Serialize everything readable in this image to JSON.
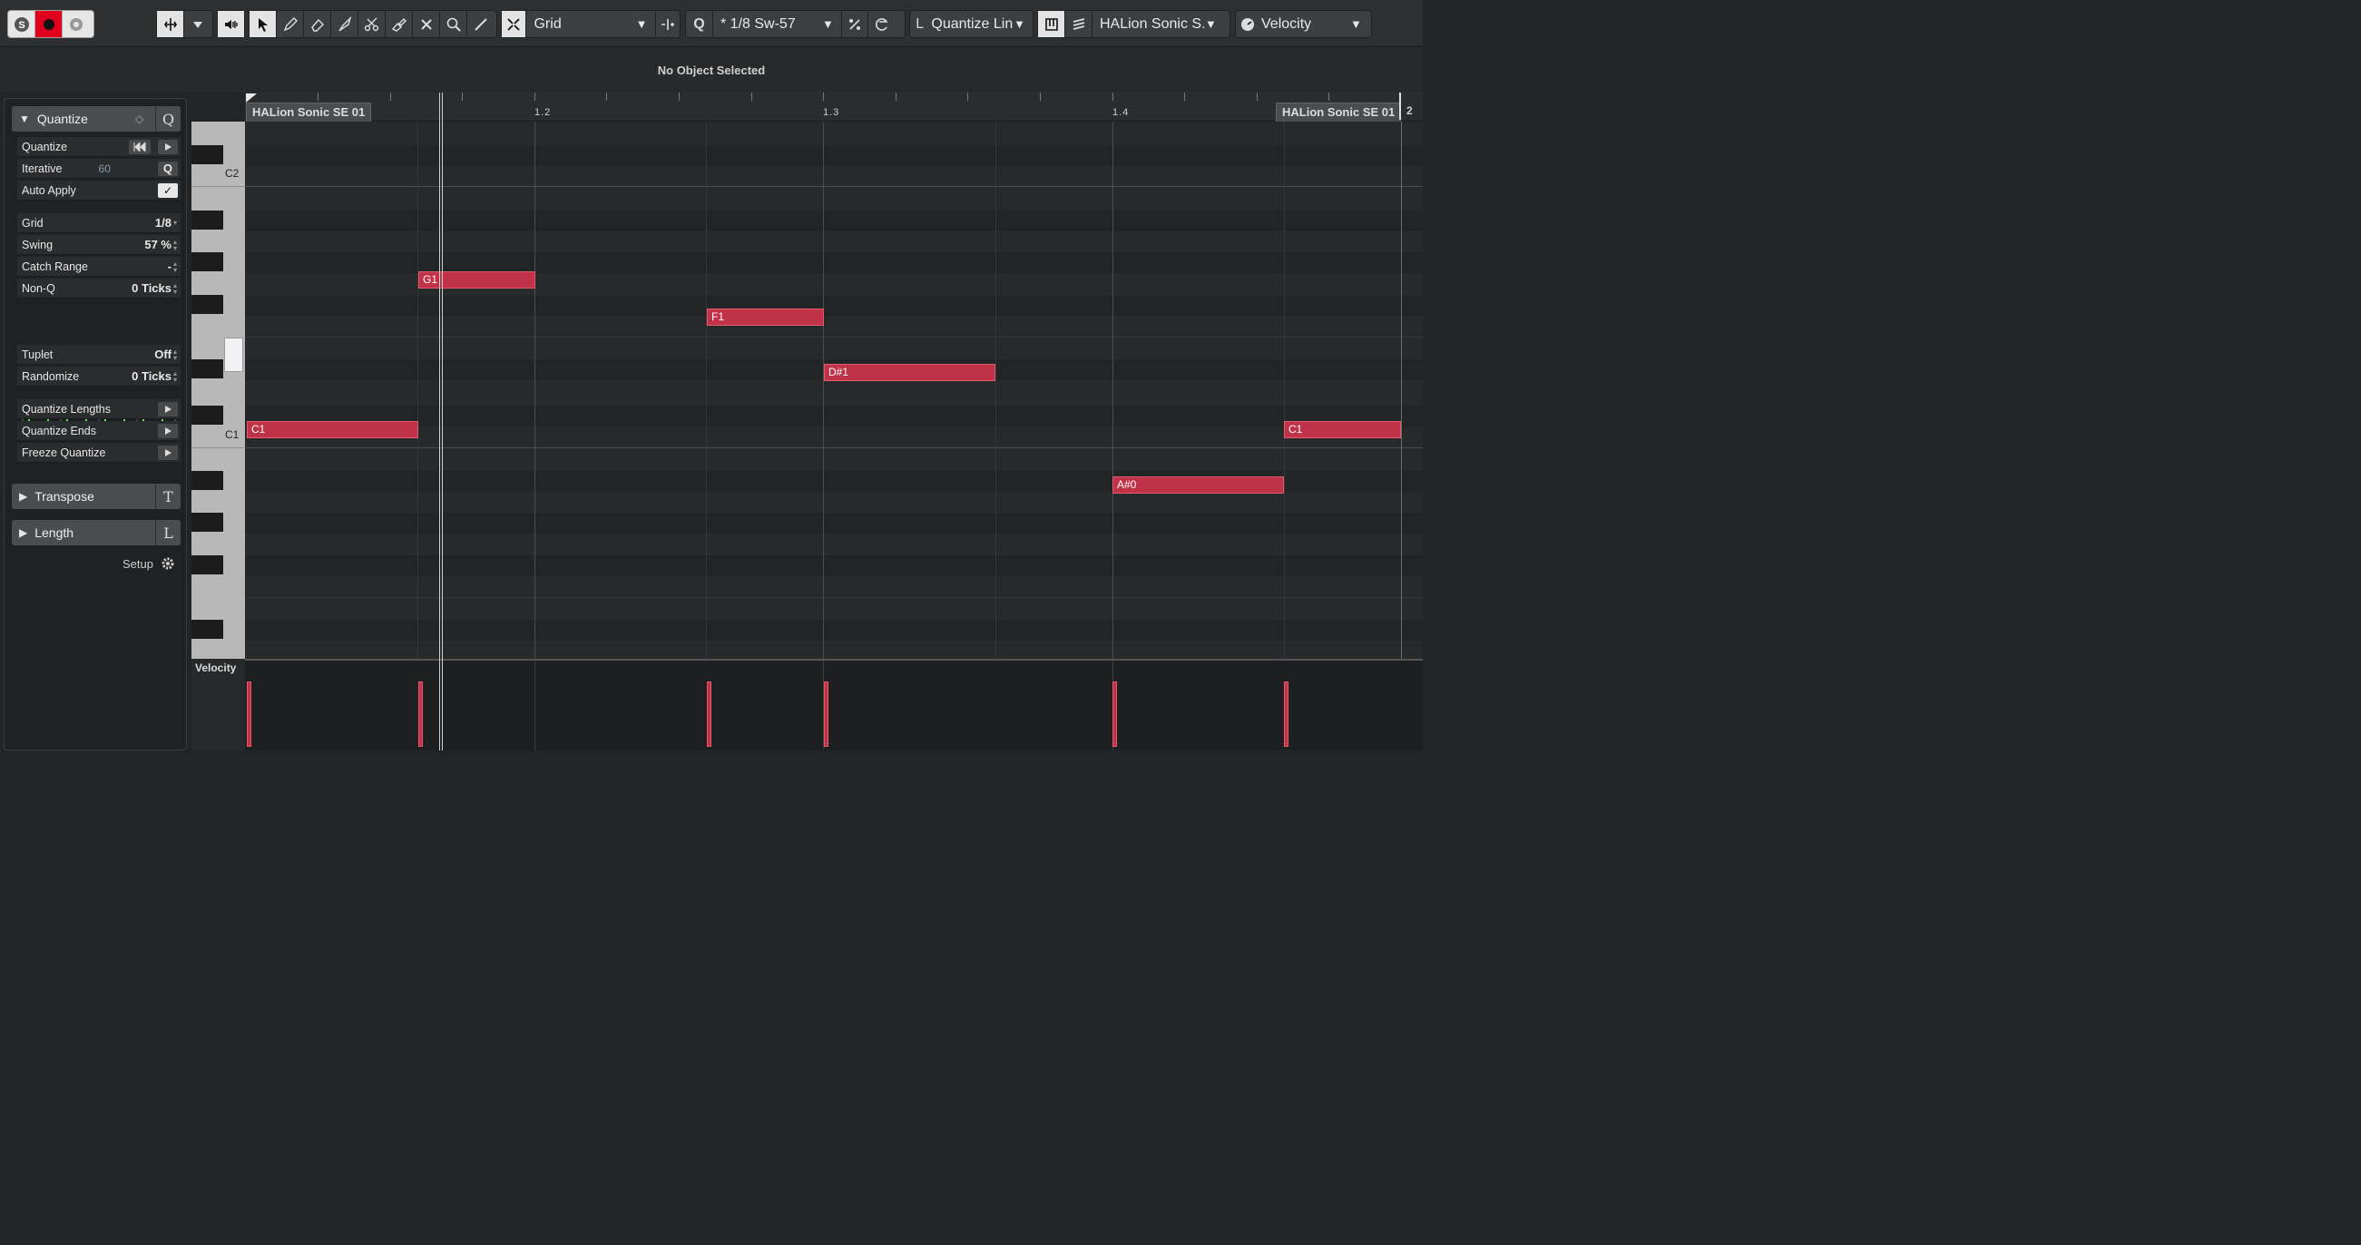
{
  "toolbar": {
    "snap_type": "Grid",
    "quantize_preset": "* 1/8  Sw-57",
    "quantize_mode": "Quantize Lin",
    "instrument": "HALion Sonic S.",
    "controller": "Velocity",
    "quantize_key": "Q"
  },
  "info_line": {
    "text": "No Object Selected"
  },
  "ruler": {
    "labels": [
      "1.2",
      "1.3",
      "1.4",
      "2"
    ],
    "part_name_left": "HALion Sonic SE 01",
    "part_name_right": "HALion Sonic SE 01"
  },
  "keyboard": {
    "labels": [
      "C2",
      "C1"
    ]
  },
  "notes": [
    {
      "pitch": "C1"
    },
    {
      "pitch": "G1"
    },
    {
      "pitch": "F1"
    },
    {
      "pitch": "D#1"
    },
    {
      "pitch": "A#0"
    },
    {
      "pitch": "C1"
    }
  ],
  "inspector": {
    "quantize": {
      "header": "Quantize",
      "key": "Q",
      "rows": {
        "quantize": "Quantize",
        "iterative": "Iterative",
        "iterative_value": "60",
        "auto_apply": "Auto Apply",
        "grid": "Grid",
        "grid_value": "1/8",
        "swing": "Swing",
        "swing_value": "57 %",
        "catch_range": "Catch Range",
        "catch_range_value": "-",
        "non_q": "Non-Q",
        "non_q_value": "0 Ticks",
        "tuplet": "Tuplet",
        "tuplet_value": "Off",
        "randomize": "Randomize",
        "randomize_value": "0 Ticks",
        "quantize_lengths": "Quantize Lengths",
        "quantize_ends": "Quantize Ends",
        "freeze_quantize": "Freeze Quantize"
      },
      "grid_preview_numbers": [
        "1",
        "2",
        "3",
        "4"
      ]
    },
    "transpose": {
      "header": "Transpose",
      "key": "T"
    },
    "length": {
      "header": "Length",
      "key": "L"
    },
    "setup_label": "Setup"
  },
  "velocity_lane": {
    "label": "Velocity"
  }
}
